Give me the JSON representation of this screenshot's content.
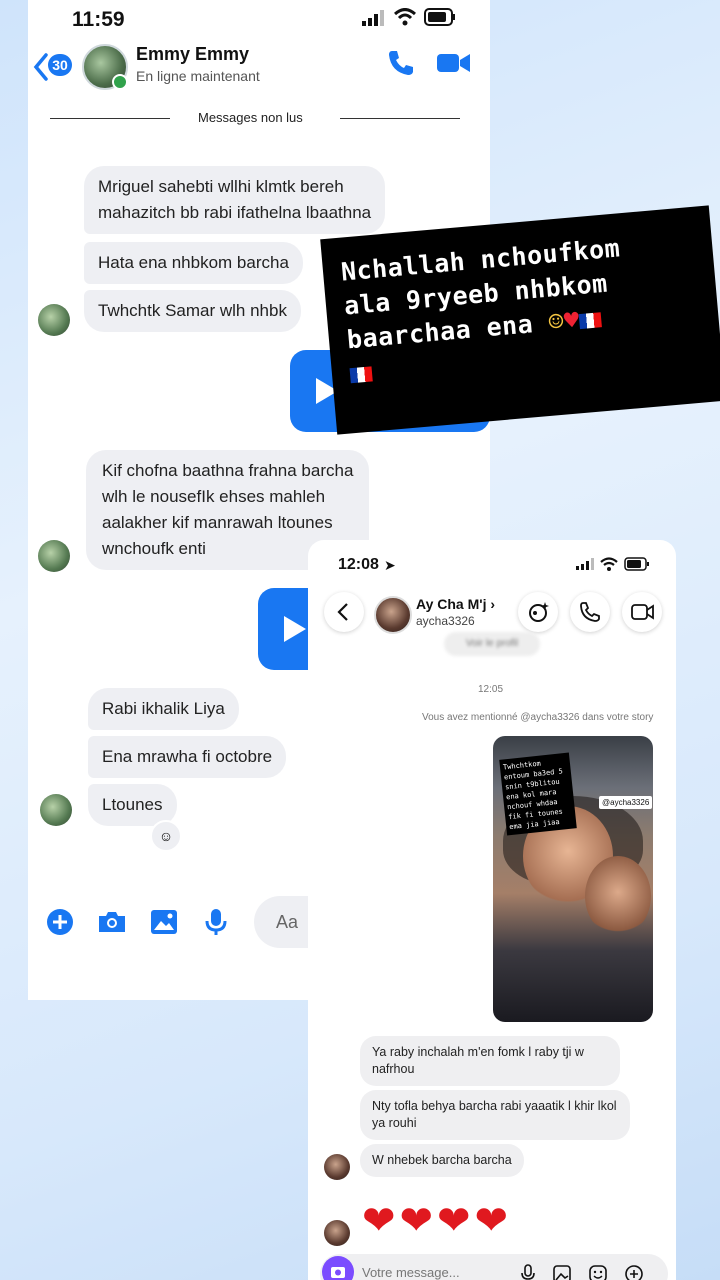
{
  "messenger": {
    "status_time": "11:59",
    "back_badge": "30",
    "contact_name": "Emmy Emmy",
    "contact_status": "En ligne maintenant",
    "divider_text": "Messages non lus",
    "messages": [
      "Mriguel sahebti wllhi klmtk bereh",
      "mahazitch bb rabi ifathelna lbaathna",
      "Hata ena nhbkom barcha",
      "Twhchtk Samar wlh nhbk",
      "Kif chofna baathna frahna barcha",
      "wlh le nousefIk ehses mahleh",
      "aalakher kif manrawah ltounes",
      "wnchoufk enti",
      "Rabi ikhalik Liya",
      "Ena mrawha fi octobre",
      "Ltounes"
    ],
    "composer_placeholder": "Aa",
    "accent": "#1977f2"
  },
  "caption": {
    "line1": "Nchallah nchoufkom",
    "line2": "ala 9ryeeb nhbkom",
    "line3": "baarchaa ena"
  },
  "instagram": {
    "status_time": "12:08",
    "contact_name": "Ay Cha M'j",
    "contact_username": "aycha3326",
    "view_profile": "Voir le profil",
    "timestamp": "12:05",
    "mention_notice": "Vous avez mentionné @aycha3326 dans votre story",
    "story_caption": "Twhchtkom entoum ba3ed 5 snin t9blitou ena kol mara nchouf whdaa fik fi tounes ema jia jiaa",
    "story_tag": "@aycha3326",
    "messages": [
      "Ya raby inchalah  m'en fomk l raby tji w nafrhou",
      "Nty tofla behya barcha rabi yaaatik l khir lkol ya rouhi",
      "W nhebek barcha barcha"
    ],
    "hearts": "❤❤❤❤",
    "composer_placeholder": "Votre message..."
  }
}
